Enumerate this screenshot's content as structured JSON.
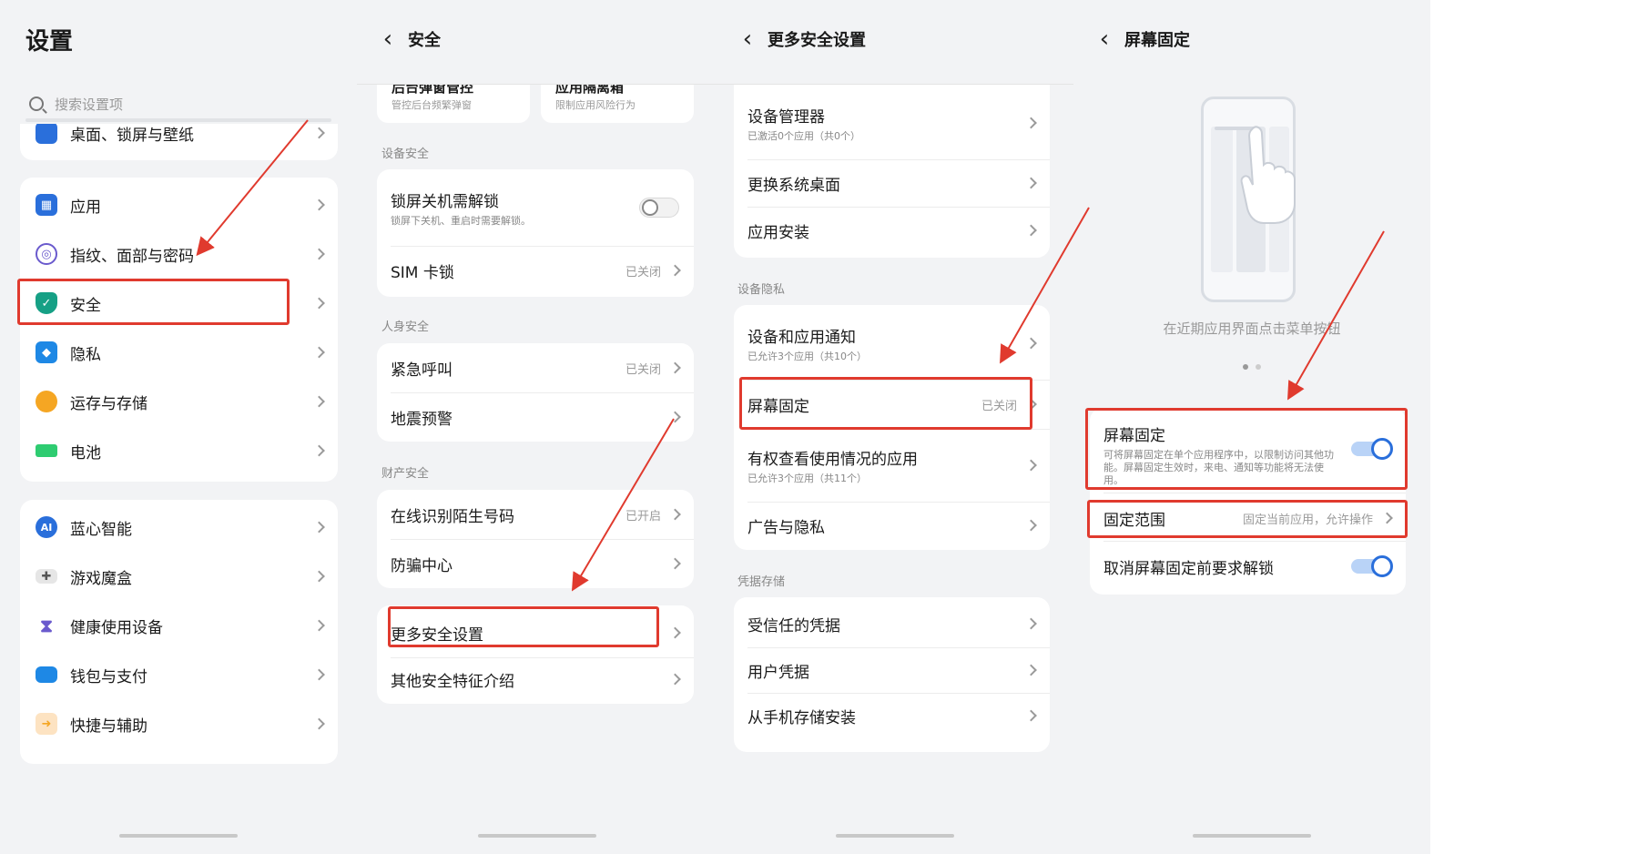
{
  "panel1": {
    "title": "设置",
    "search_placeholder": "搜索设置项",
    "partial_item": "桌面、锁屏与壁纸",
    "group1": [
      {
        "label": "应用",
        "icon": "apps-icon",
        "color": "#2a6fdb"
      },
      {
        "label": "指纹、面部与密码",
        "icon": "fingerprint-icon",
        "color": "#6a5acd"
      },
      {
        "label": "安全",
        "icon": "shield-icon",
        "color": "#16a085"
      },
      {
        "label": "隐私",
        "icon": "privacy-cube-icon",
        "color": "#1e88e5"
      },
      {
        "label": "运存与存储",
        "icon": "storage-pie-icon",
        "color": "#f5a623"
      },
      {
        "label": "电池",
        "icon": "battery-icon",
        "color": "#2ecc71"
      }
    ],
    "group2": [
      {
        "label": "蓝心智能",
        "icon": "ai-icon",
        "color": "#2a6fdb"
      },
      {
        "label": "游戏魔盒",
        "icon": "gamepad-icon",
        "color": "#888888"
      },
      {
        "label": "健康使用设备",
        "icon": "hourglass-icon",
        "color": "#6a5acd"
      },
      {
        "label": "钱包与支付",
        "icon": "wallet-icon",
        "color": "#1e88e5"
      },
      {
        "label": "快捷与辅助",
        "icon": "shortcut-icon",
        "color": "#f5a623"
      }
    ]
  },
  "panel2": {
    "title": "安全",
    "top_cards": [
      {
        "title": "后台弹窗管控",
        "sub": "管控后台频繁弹窗"
      },
      {
        "title": "应用隔离箱",
        "sub": "限制应用风险行为"
      }
    ],
    "section_device": "设备安全",
    "lock_title": "锁屏关机需解锁",
    "lock_sub": "锁屏下关机、重启时需要解锁。",
    "sim_lock": "SIM 卡锁",
    "sim_value": "已关闭",
    "section_personal": "人身安全",
    "emergency": "紧急呼叫",
    "emergency_value": "已关闭",
    "earthquake": "地震预警",
    "section_property": "财产安全",
    "identify": "在线识别陌生号码",
    "identify_value": "已开启",
    "anti_fraud": "防骗中心",
    "more_security": "更多安全设置",
    "other_features": "其他安全特征介绍"
  },
  "panel3": {
    "title": "更多安全设置",
    "device_admin": "设备管理器",
    "device_admin_sub": "已激活0个应用（共0个）",
    "change_launcher": "更换系统桌面",
    "app_install": "应用安装",
    "section_privacy": "设备隐私",
    "notifications": "设备和应用通知",
    "notifications_sub": "已允许3个应用（共10个）",
    "screen_pin": "屏幕固定",
    "screen_pin_value": "已关闭",
    "usage_access": "有权查看使用情况的应用",
    "usage_access_sub": "已允许3个应用（共11个）",
    "ads_privacy": "广告与隐私",
    "section_credentials": "凭据存储",
    "trusted_credentials": "受信任的凭据",
    "user_credentials": "用户凭据",
    "install_from_storage": "从手机存储安装"
  },
  "panel4": {
    "title": "屏幕固定",
    "caption": "在近期应用界面点击菜单按钮",
    "pin_title": "屏幕固定",
    "pin_desc": "可将屏幕固定在单个应用程序中，以限制访问其他功能。屏幕固定生效时，来电、通知等功能将无法使用。",
    "pin_toggle": true,
    "scope_label": "固定范围",
    "scope_value": "固定当前应用，允许操作",
    "unlock_label": "取消屏幕固定前要求解锁",
    "unlock_toggle": true
  },
  "colors": {
    "highlight": "#e03a2e",
    "toggle_on": "#2a6fdb",
    "background": "#f2f3f5"
  }
}
